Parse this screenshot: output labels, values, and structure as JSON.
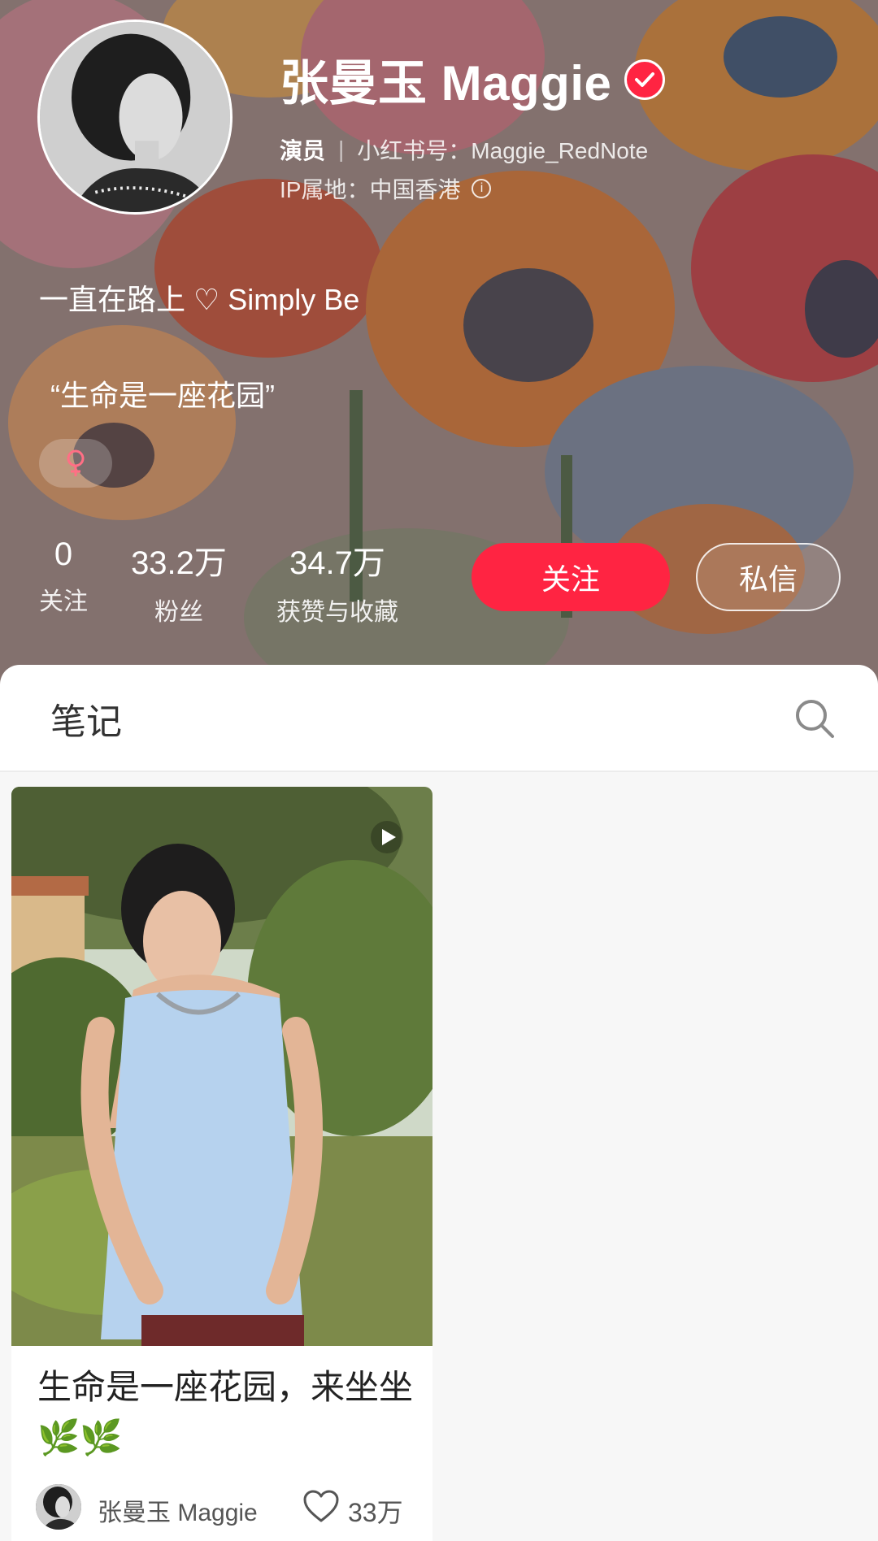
{
  "profile": {
    "name": "张曼玉 Maggie",
    "role": "演员",
    "separator": "|",
    "redbook_id": "小红书号：Maggie_RedNote",
    "ip_location": "IP属地：中国香港",
    "bio_line1": "一直在路上 ♡ Simply Be",
    "bio_line2": "“生命是一座花园”",
    "gender_symbol": "♀"
  },
  "stats": {
    "following_count": "0",
    "following_label": "关注",
    "fans_count": "33.2万",
    "fans_label": "粉丝",
    "likes_count": "34.7万",
    "likes_label": "获赞与收藏"
  },
  "actions": {
    "follow_label": "关注",
    "message_label": "私信"
  },
  "tabs": {
    "notes_label": "笔记"
  },
  "notes": [
    {
      "title": "生命是一座花园，来坐坐🌿🌿",
      "author": "张曼玉 Maggie",
      "likes": "33万"
    }
  ],
  "colors": {
    "accent": "#ff2442",
    "background": "#f7f7f7"
  }
}
